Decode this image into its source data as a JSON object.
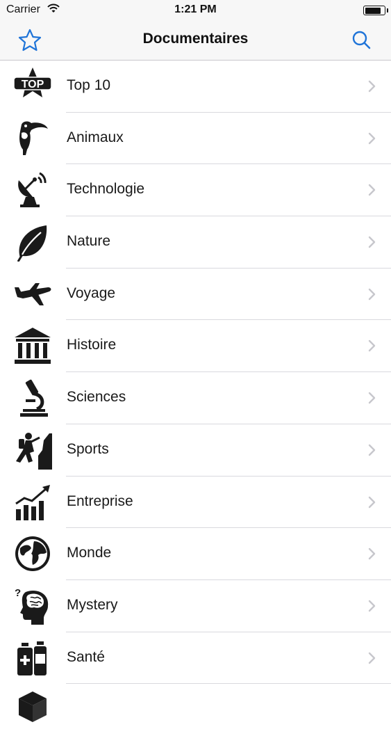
{
  "status_bar": {
    "carrier": "Carrier",
    "time": "1:21 PM",
    "battery_level": 0.75
  },
  "nav": {
    "title": "Documentaires",
    "left_icon": "star-icon",
    "right_icon": "search-icon",
    "accent": "#1f74d8"
  },
  "categories": [
    {
      "label": "Top 10",
      "icon": "top-10-icon"
    },
    {
      "label": "Animaux",
      "icon": "toucan-icon"
    },
    {
      "label": "Technologie",
      "icon": "satellite-dish-icon"
    },
    {
      "label": "Nature",
      "icon": "leaf-icon"
    },
    {
      "label": "Voyage",
      "icon": "airplane-icon"
    },
    {
      "label": "Histoire",
      "icon": "museum-icon"
    },
    {
      "label": "Sciences",
      "icon": "microscope-icon"
    },
    {
      "label": "Sports",
      "icon": "climber-icon"
    },
    {
      "label": "Entreprise",
      "icon": "growth-chart-icon"
    },
    {
      "label": "Monde",
      "icon": "globe-icon"
    },
    {
      "label": "Mystery",
      "icon": "brain-question-icon"
    },
    {
      "label": "Santé",
      "icon": "medicine-bottles-icon"
    }
  ],
  "top_badge_text": "TOP",
  "mystery_mark": "?"
}
